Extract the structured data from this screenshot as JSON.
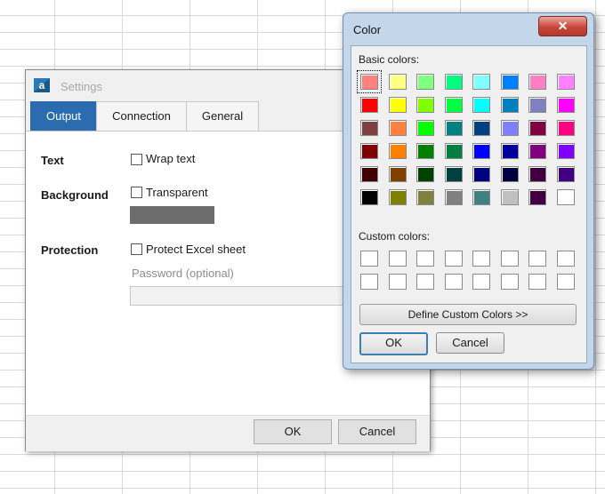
{
  "settings": {
    "logo_letter": "a",
    "title": "Settings",
    "tabs": [
      {
        "label": "Output"
      },
      {
        "label": "Connection"
      },
      {
        "label": "General"
      }
    ],
    "active_tab": "Output",
    "rows": {
      "text_label": "Text",
      "wrap_text": {
        "label": "Wrap text",
        "checked": false
      },
      "background_label": "Background",
      "transparent": {
        "label": "Transparent",
        "checked": false
      },
      "background_color": "#6d6d6d",
      "protection_label": "Protection",
      "protect_sheet": {
        "label": "Protect Excel sheet",
        "checked": false
      },
      "password_placeholder": "Password (optional)",
      "password_value": ""
    },
    "buttons": {
      "ok": "OK",
      "cancel": "Cancel"
    }
  },
  "color_dialog": {
    "title": "Color",
    "close_glyph": "✕",
    "basic_colors_label": "Basic colors:",
    "custom_colors_label": "Custom colors:",
    "basic_colors": [
      [
        "#ff8080",
        "#ffff80",
        "#80ff80",
        "#00ff80",
        "#80ffff",
        "#0080ff",
        "#ff80c0",
        "#ff80ff"
      ],
      [
        "#ff0000",
        "#ffff00",
        "#80ff00",
        "#00ff40",
        "#00ffff",
        "#0080c0",
        "#8080c0",
        "#ff00ff"
      ],
      [
        "#804040",
        "#ff8040",
        "#00ff00",
        "#008080",
        "#004080",
        "#8080ff",
        "#800040",
        "#ff0080"
      ],
      [
        "#800000",
        "#ff8000",
        "#008000",
        "#008040",
        "#0000ff",
        "#0000a0",
        "#800080",
        "#8000ff"
      ],
      [
        "#400000",
        "#804000",
        "#004000",
        "#004040",
        "#000080",
        "#000040",
        "#400040",
        "#400080"
      ],
      [
        "#000000",
        "#808000",
        "#808040",
        "#808080",
        "#408080",
        "#c0c0c0",
        "#400040",
        "#ffffff"
      ]
    ],
    "selected_color": "#ff8080",
    "custom_colors": [
      [
        "#ffffff",
        "#ffffff",
        "#ffffff",
        "#ffffff",
        "#ffffff",
        "#ffffff",
        "#ffffff",
        "#ffffff"
      ],
      [
        "#ffffff",
        "#ffffff",
        "#ffffff",
        "#ffffff",
        "#ffffff",
        "#ffffff",
        "#ffffff",
        "#ffffff"
      ]
    ],
    "define_custom_label": "Define Custom Colors >>",
    "ok_label": "OK",
    "cancel_label": "Cancel"
  }
}
